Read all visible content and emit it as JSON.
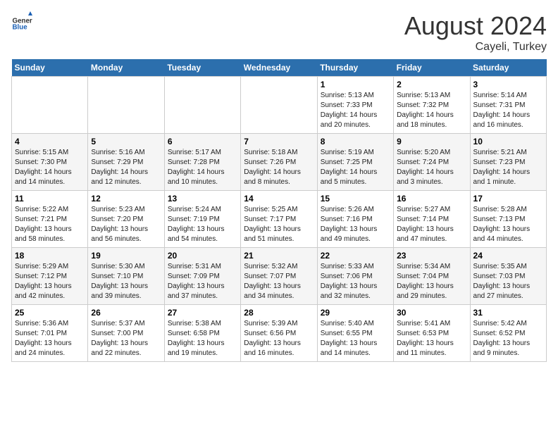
{
  "header": {
    "logo_general": "General",
    "logo_blue": "Blue",
    "month_year": "August 2024",
    "location": "Cayeli, Turkey"
  },
  "weekdays": [
    "Sunday",
    "Monday",
    "Tuesday",
    "Wednesday",
    "Thursday",
    "Friday",
    "Saturday"
  ],
  "weeks": [
    [
      {
        "day": "",
        "info": ""
      },
      {
        "day": "",
        "info": ""
      },
      {
        "day": "",
        "info": ""
      },
      {
        "day": "",
        "info": ""
      },
      {
        "day": "1",
        "info": "Sunrise: 5:13 AM\nSunset: 7:33 PM\nDaylight: 14 hours\nand 20 minutes."
      },
      {
        "day": "2",
        "info": "Sunrise: 5:13 AM\nSunset: 7:32 PM\nDaylight: 14 hours\nand 18 minutes."
      },
      {
        "day": "3",
        "info": "Sunrise: 5:14 AM\nSunset: 7:31 PM\nDaylight: 14 hours\nand 16 minutes."
      }
    ],
    [
      {
        "day": "4",
        "info": "Sunrise: 5:15 AM\nSunset: 7:30 PM\nDaylight: 14 hours\nand 14 minutes."
      },
      {
        "day": "5",
        "info": "Sunrise: 5:16 AM\nSunset: 7:29 PM\nDaylight: 14 hours\nand 12 minutes."
      },
      {
        "day": "6",
        "info": "Sunrise: 5:17 AM\nSunset: 7:28 PM\nDaylight: 14 hours\nand 10 minutes."
      },
      {
        "day": "7",
        "info": "Sunrise: 5:18 AM\nSunset: 7:26 PM\nDaylight: 14 hours\nand 8 minutes."
      },
      {
        "day": "8",
        "info": "Sunrise: 5:19 AM\nSunset: 7:25 PM\nDaylight: 14 hours\nand 5 minutes."
      },
      {
        "day": "9",
        "info": "Sunrise: 5:20 AM\nSunset: 7:24 PM\nDaylight: 14 hours\nand 3 minutes."
      },
      {
        "day": "10",
        "info": "Sunrise: 5:21 AM\nSunset: 7:23 PM\nDaylight: 14 hours\nand 1 minute."
      }
    ],
    [
      {
        "day": "11",
        "info": "Sunrise: 5:22 AM\nSunset: 7:21 PM\nDaylight: 13 hours\nand 58 minutes."
      },
      {
        "day": "12",
        "info": "Sunrise: 5:23 AM\nSunset: 7:20 PM\nDaylight: 13 hours\nand 56 minutes."
      },
      {
        "day": "13",
        "info": "Sunrise: 5:24 AM\nSunset: 7:19 PM\nDaylight: 13 hours\nand 54 minutes."
      },
      {
        "day": "14",
        "info": "Sunrise: 5:25 AM\nSunset: 7:17 PM\nDaylight: 13 hours\nand 51 minutes."
      },
      {
        "day": "15",
        "info": "Sunrise: 5:26 AM\nSunset: 7:16 PM\nDaylight: 13 hours\nand 49 minutes."
      },
      {
        "day": "16",
        "info": "Sunrise: 5:27 AM\nSunset: 7:14 PM\nDaylight: 13 hours\nand 47 minutes."
      },
      {
        "day": "17",
        "info": "Sunrise: 5:28 AM\nSunset: 7:13 PM\nDaylight: 13 hours\nand 44 minutes."
      }
    ],
    [
      {
        "day": "18",
        "info": "Sunrise: 5:29 AM\nSunset: 7:12 PM\nDaylight: 13 hours\nand 42 minutes."
      },
      {
        "day": "19",
        "info": "Sunrise: 5:30 AM\nSunset: 7:10 PM\nDaylight: 13 hours\nand 39 minutes."
      },
      {
        "day": "20",
        "info": "Sunrise: 5:31 AM\nSunset: 7:09 PM\nDaylight: 13 hours\nand 37 minutes."
      },
      {
        "day": "21",
        "info": "Sunrise: 5:32 AM\nSunset: 7:07 PM\nDaylight: 13 hours\nand 34 minutes."
      },
      {
        "day": "22",
        "info": "Sunrise: 5:33 AM\nSunset: 7:06 PM\nDaylight: 13 hours\nand 32 minutes."
      },
      {
        "day": "23",
        "info": "Sunrise: 5:34 AM\nSunset: 7:04 PM\nDaylight: 13 hours\nand 29 minutes."
      },
      {
        "day": "24",
        "info": "Sunrise: 5:35 AM\nSunset: 7:03 PM\nDaylight: 13 hours\nand 27 minutes."
      }
    ],
    [
      {
        "day": "25",
        "info": "Sunrise: 5:36 AM\nSunset: 7:01 PM\nDaylight: 13 hours\nand 24 minutes."
      },
      {
        "day": "26",
        "info": "Sunrise: 5:37 AM\nSunset: 7:00 PM\nDaylight: 13 hours\nand 22 minutes."
      },
      {
        "day": "27",
        "info": "Sunrise: 5:38 AM\nSunset: 6:58 PM\nDaylight: 13 hours\nand 19 minutes."
      },
      {
        "day": "28",
        "info": "Sunrise: 5:39 AM\nSunset: 6:56 PM\nDaylight: 13 hours\nand 16 minutes."
      },
      {
        "day": "29",
        "info": "Sunrise: 5:40 AM\nSunset: 6:55 PM\nDaylight: 13 hours\nand 14 minutes."
      },
      {
        "day": "30",
        "info": "Sunrise: 5:41 AM\nSunset: 6:53 PM\nDaylight: 13 hours\nand 11 minutes."
      },
      {
        "day": "31",
        "info": "Sunrise: 5:42 AM\nSunset: 6:52 PM\nDaylight: 13 hours\nand 9 minutes."
      }
    ]
  ]
}
